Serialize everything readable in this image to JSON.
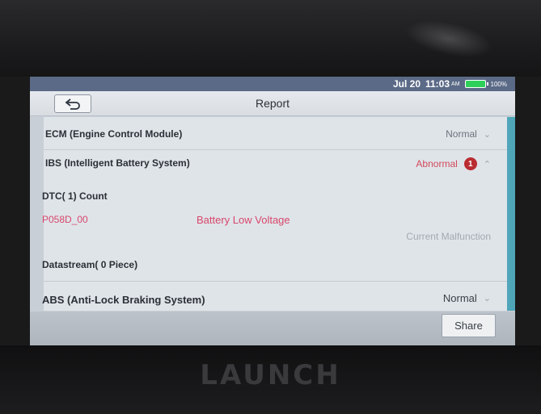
{
  "status_bar": {
    "date": "Jul 20",
    "time": "11:03",
    "ampm": "AM",
    "battery_percent": "100%",
    "battery_icon": "battery-full-icon"
  },
  "header": {
    "title": "Report",
    "back_icon": "back-arrow-icon"
  },
  "systems": [
    {
      "name": "ECM (Engine Control Module)",
      "status": "Normal",
      "expanded": false,
      "chevron_icon": "chevron-down-icon"
    },
    {
      "name": "IBS (Intelligent Battery System)",
      "status": "Abnormal",
      "badge_count": "1",
      "expanded": true,
      "chevron_icon": "chevron-up-icon"
    },
    {
      "name": "ABS (Anti-Lock Braking System)",
      "status": "Normal",
      "expanded": false,
      "chevron_icon": "chevron-down-icon"
    }
  ],
  "ibs_details": {
    "dtc_count_label": "DTC( 1) Count",
    "dtcs": [
      {
        "code": "P058D_00",
        "description": "Battery Low Voltage",
        "state": "Current Malfunction"
      }
    ],
    "datastream_label": "Datastream( 0 Piece)"
  },
  "footer": {
    "share_label": "Share"
  },
  "device": {
    "brand": "LAUNCH"
  },
  "colors": {
    "status_bar": "#5b6a86",
    "abnormal_text": "#d24a5a",
    "dtc_text": "#d8476a",
    "badge": "#b92d32",
    "accent": "#4fa6b8"
  }
}
